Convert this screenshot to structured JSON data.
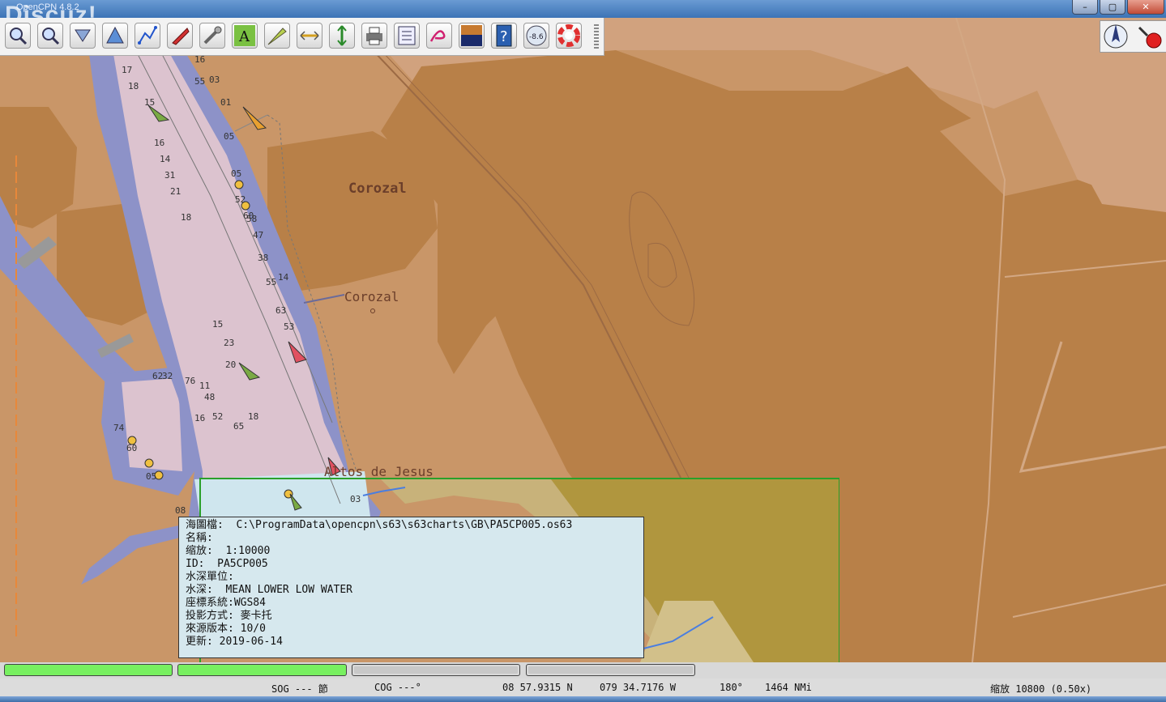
{
  "window": {
    "title": "OpenCPN 4.8.2",
    "watermark": "Discuz!",
    "controls": {
      "minimize": "–",
      "maximize": "▢",
      "close": "✕"
    }
  },
  "toolbar": {
    "buttons": [
      {
        "name": "zoom-in-button",
        "icon": "magnifier-plus-icon"
      },
      {
        "name": "zoom-out-button",
        "icon": "magnifier-minus-icon"
      },
      {
        "name": "scale-in-button",
        "icon": "scale-in-icon"
      },
      {
        "name": "scale-out-button",
        "icon": "scale-out-icon"
      },
      {
        "name": "route-button",
        "icon": "route-icon"
      },
      {
        "name": "auto-follow-button",
        "icon": "ship-icon"
      },
      {
        "name": "options-button",
        "icon": "wrench-icon"
      },
      {
        "name": "text-button",
        "icon": "text-icon"
      },
      {
        "name": "current-button",
        "icon": "current-icon"
      },
      {
        "name": "tide-button",
        "icon": "tide-icon"
      },
      {
        "name": "measure-button",
        "icon": "measure-icon"
      },
      {
        "name": "print-button",
        "icon": "printer-icon"
      },
      {
        "name": "route-manager-button",
        "icon": "list-icon"
      },
      {
        "name": "track-button",
        "icon": "track-icon"
      },
      {
        "name": "color-scheme-button",
        "icon": "day-night-icon"
      },
      {
        "name": "help-button",
        "icon": "help-icon"
      },
      {
        "name": "dashboard-button",
        "icon": "gauge-icon"
      },
      {
        "name": "mob-button",
        "icon": "lifebuoy-icon"
      }
    ],
    "gauge_value": "-8.6",
    "help_glyph": "?",
    "text_glyph": "A"
  },
  "map": {
    "labels": [
      {
        "text": "Corozal",
        "name": "place-label-corozal-1"
      },
      {
        "text": "Corozal",
        "name": "place-label-corozal-2"
      },
      {
        "text": "Altos de Jesus",
        "name": "place-label-altos"
      }
    ],
    "soundings": [
      "16",
      "55",
      "03",
      "17",
      "18",
      "01",
      "15",
      "05",
      "16",
      "14",
      "05",
      "31",
      "21",
      "60",
      "52",
      "58",
      "38",
      "47",
      "55",
      "14",
      "63",
      "53",
      "18",
      "23",
      "15",
      "20",
      "62",
      "32",
      "76",
      "11",
      "48",
      "16",
      "52",
      "65",
      "18",
      "74",
      "60",
      "05",
      "03",
      "08"
    ]
  },
  "info_popup": {
    "lines": [
      "海圖檔:  C:\\ProgramData\\opencpn\\s63\\s63charts\\GB\\PA5CP005.os63",
      "名稱:",
      "缩放:  1:10000",
      "ID:  PA5CP005",
      "水深單位:",
      "水深:  MEAN LOWER LOW WATER",
      "座標系統:WGS84",
      "投影方式: 麥卡托",
      "來源版本: 10/0",
      "更新: 2019-06-14"
    ]
  },
  "status": {
    "sog": "SOG --- 節",
    "cog": "COG ---°",
    "lat": "08 57.9315 N",
    "lon": "079 34.7176 W",
    "bearing": "180°",
    "distance": "1464 NMi",
    "scale": "缩放 10800 (0.50x)"
  },
  "colors": {
    "land": "#c99668",
    "land_light": "#d1a27e",
    "land_dark": "#b88048",
    "water_deep": "#8d92c8",
    "channel": "#dcc3cf",
    "coverage_green": "#2aa02a",
    "popup_bg": "#d6e8ee",
    "chart_bar_on": "#78f060"
  }
}
